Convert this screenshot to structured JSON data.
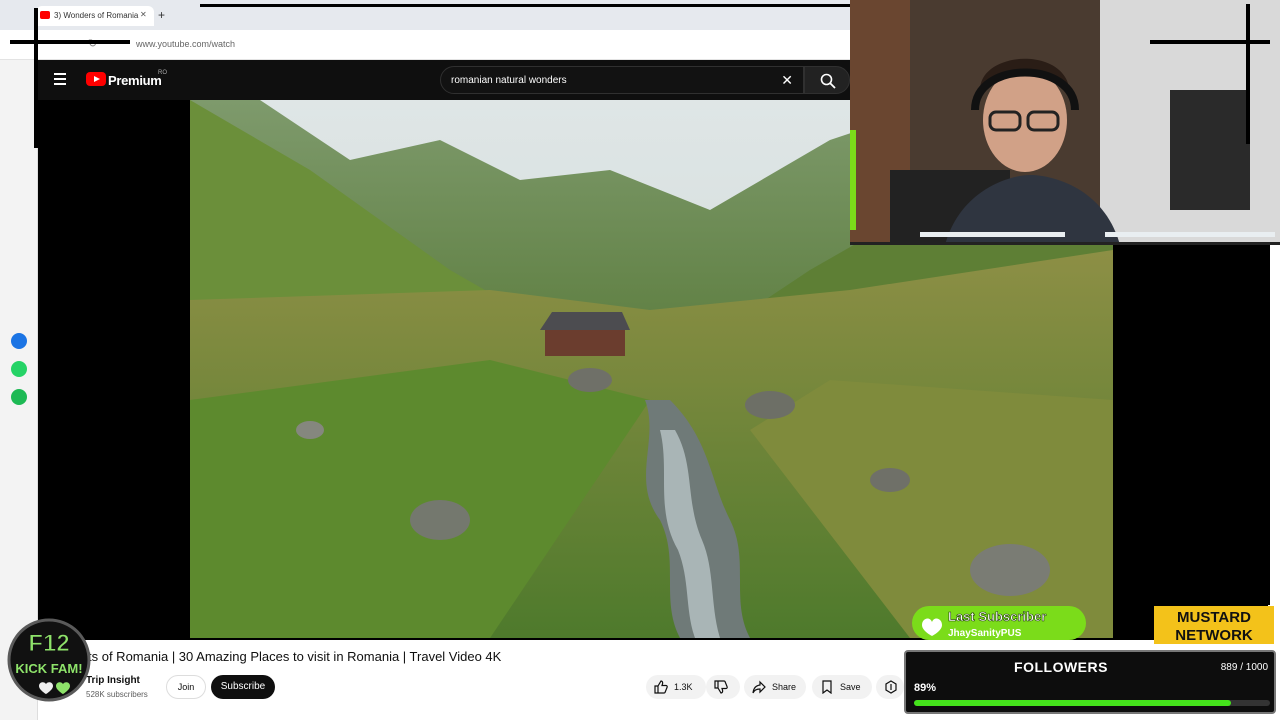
{
  "browser": {
    "tab_title": "3) Wonders of Romania",
    "new_tab_symbol": "+",
    "tab_close_symbol": "✕",
    "url": "www.youtube.com/watch"
  },
  "youtube": {
    "logo_label": "Premium",
    "country_code": "RO",
    "search": {
      "query": "romanian natural wonders",
      "clear_symbol": "✕"
    }
  },
  "video": {
    "title_visible": "ts of Romania | 30 Amazing Places to visit in Romania | Travel Video 4K",
    "channel_name": "Trip Insight",
    "subscribers": "528K subscribers",
    "join_label": "Join",
    "subscribe_label": "Subscribe",
    "likes": "1.3K",
    "share_label": "Share",
    "save_label": "Save"
  },
  "overlays": {
    "f12_badge": {
      "line1": "F12",
      "line2": "KICK FAM!"
    },
    "last_subscriber": {
      "label": "Last Subscriber",
      "name": "JhaySanityPUS"
    },
    "mustard_network": {
      "line1": "MUSTARD",
      "line2": "NETWORK"
    },
    "followers": {
      "title": "FOLLOWERS",
      "count_text": "889 / 1000",
      "percent_text": "89%",
      "progress": 0.89
    }
  },
  "colors": {
    "youtube_red": "#ff0000",
    "follower_bar": "#44e21b",
    "last_sub_green": "#7bdc1a",
    "mustard_yellow": "#f3c21a"
  }
}
